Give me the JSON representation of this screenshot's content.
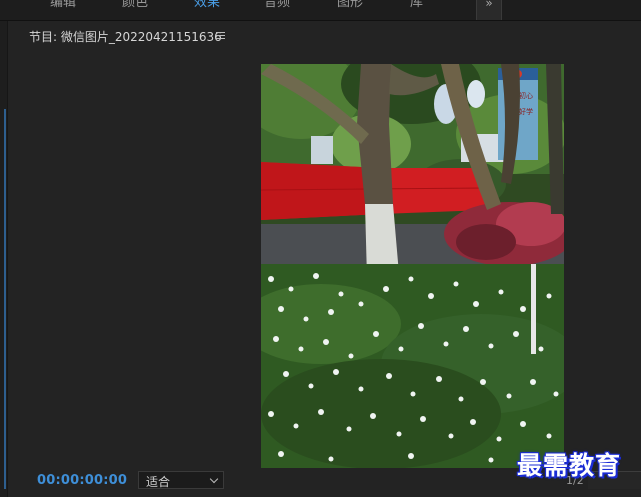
{
  "workspace_tabs": [
    {
      "label": "编辑",
      "active": false
    },
    {
      "label": "颜色",
      "active": false
    },
    {
      "label": "效果",
      "active": true
    },
    {
      "label": "音频",
      "active": false
    },
    {
      "label": "图形",
      "active": false
    },
    {
      "label": "库",
      "active": false
    }
  ],
  "workspace_more_label": "»",
  "monitor": {
    "title": "节目: 微信图片_20220421151636",
    "timecode": "00:00:00:00",
    "fit_value": "适合",
    "resolution": "1/2"
  },
  "frame_image": {
    "sign_text": [
      "不忘初心",
      "敬需好学"
    ]
  },
  "watermark": "最需教育",
  "colors": {
    "accent": "#3e8fd8",
    "panel_bg": "#232323",
    "watermark_outline": "#1a2bd6"
  },
  "icons": {
    "panel_menu": "hamburger-icon",
    "workspace_menu": "hamburger-icon",
    "dropdown": "chevron-down-icon"
  }
}
